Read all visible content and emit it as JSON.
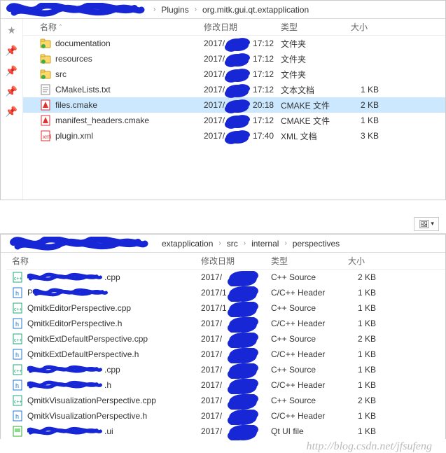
{
  "window1": {
    "breadcrumb": [
      "Plugins",
      "org.mitk.gui.qt.extapplication"
    ],
    "columns": {
      "name": "名称",
      "date": "修改日期",
      "type": "类型",
      "size": "大小"
    },
    "rows": [
      {
        "icon": "folder-doc",
        "name": "documentation",
        "date": "2017/",
        "time": "17:12",
        "type": "文件夹",
        "size": "",
        "selected": false
      },
      {
        "icon": "folder",
        "name": "resources",
        "date": "2017/",
        "time": "17:12",
        "type": "文件夹",
        "size": "",
        "selected": false
      },
      {
        "icon": "folder",
        "name": "src",
        "date": "2017/",
        "time": "17:12",
        "type": "文件夹",
        "size": "",
        "selected": false
      },
      {
        "icon": "txt",
        "name": "CMakeLists.txt",
        "date": "2017/",
        "time": "17:12",
        "type": "文本文档",
        "size": "1 KB",
        "selected": false
      },
      {
        "icon": "cmake",
        "name": "files.cmake",
        "date": "2017/",
        "time": "20:18",
        "type": "CMAKE 文件",
        "size": "2 KB",
        "selected": true
      },
      {
        "icon": "cmake",
        "name": "manifest_headers.cmake",
        "date": "2017/",
        "time": "17:12",
        "type": "CMAKE 文件",
        "size": "1 KB",
        "selected": false
      },
      {
        "icon": "xml",
        "name": "plugin.xml",
        "date": "2017/",
        "time": "17:40",
        "type": "XML 文档",
        "size": "3 KB",
        "selected": false
      }
    ]
  },
  "window2": {
    "breadcrumb": [
      "extapplication",
      "src",
      "internal",
      "perspectives"
    ],
    "columns": {
      "name": "名称",
      "date": "修改日期",
      "type": "类型",
      "size": "大小"
    },
    "rows": [
      {
        "icon": "cpp",
        "name_pre": "",
        "name_obs": true,
        "name_suf": ".cpp",
        "date": "2017/",
        "type": "C++ Source",
        "size": "2 KB"
      },
      {
        "icon": "h",
        "name_pre": "P",
        "name_obs": true,
        "name_suf": "",
        "date": "2017/1",
        "type": "C/C++ Header",
        "size": "1 KB"
      },
      {
        "icon": "cpp",
        "name_pre": "QmitkEditorPerspective.cpp",
        "name_obs": false,
        "name_suf": "",
        "date": "2017/1",
        "type": "C++ Source",
        "size": "1 KB"
      },
      {
        "icon": "h",
        "name_pre": "QmitkEditorPerspective.h",
        "name_obs": false,
        "name_suf": "",
        "date": "2017/",
        "type": "C/C++ Header",
        "size": "1 KB"
      },
      {
        "icon": "cpp",
        "name_pre": "QmitkExtDefaultPerspective.cpp",
        "name_obs": false,
        "name_suf": "",
        "date": "2017/",
        "type": "C++ Source",
        "size": "2 KB"
      },
      {
        "icon": "h",
        "name_pre": "QmitkExtDefaultPerspective.h",
        "name_obs": false,
        "name_suf": "",
        "date": "2017/",
        "type": "C/C++ Header",
        "size": "1 KB"
      },
      {
        "icon": "cpp",
        "name_pre": "",
        "name_obs": true,
        "name_suf": ".cpp",
        "date": "2017/",
        "type": "C++ Source",
        "size": "1 KB"
      },
      {
        "icon": "h",
        "name_pre": "",
        "name_obs": true,
        "name_suf": ".h",
        "date": "2017/",
        "type": "C/C++ Header",
        "size": "1 KB"
      },
      {
        "icon": "cpp",
        "name_pre": "QmitkVisualizationPerspective.cpp",
        "name_obs": false,
        "name_suf": "",
        "date": "2017/",
        "type": "C++ Source",
        "size": "2 KB"
      },
      {
        "icon": "h",
        "name_pre": "QmitkVisualizationPerspective.h",
        "name_obs": false,
        "name_suf": "",
        "date": "2017/",
        "type": "C/C++ Header",
        "size": "1 KB"
      },
      {
        "icon": "ui",
        "name_pre": "",
        "name_obs": true,
        "name_suf": ".ui",
        "date": "2017/",
        "type": "Qt UI file",
        "size": "1 KB"
      }
    ]
  },
  "watermark": "http://blog.csdn.net/jfsufeng"
}
